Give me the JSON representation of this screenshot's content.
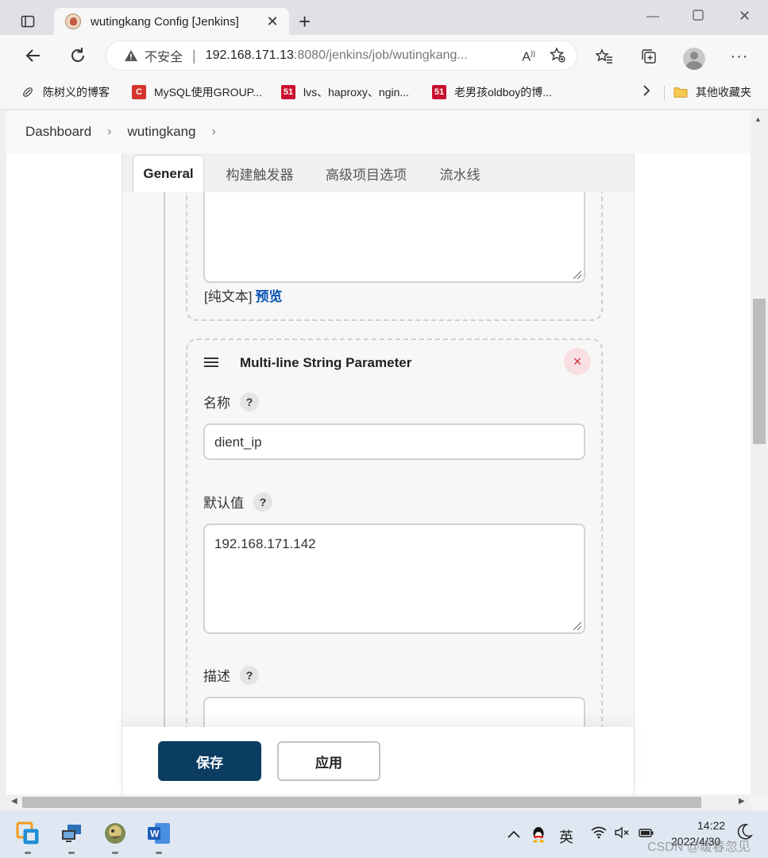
{
  "browser": {
    "tab_title": "wutingkang Config [Jenkins]",
    "security_label": "不安全",
    "url_host": "192.168.171.13",
    "url_rest": ":8080/jenkins/job/wutingkang..."
  },
  "bookmarks": [
    {
      "label": "陈树义的博客",
      "icon": "link-icon"
    },
    {
      "label": "MySQL使用GROUP...",
      "icon": "csdn-icon",
      "badge": "C",
      "color": "#d4342b"
    },
    {
      "label": "lvs、haproxy、ngin...",
      "icon": "51cto-icon",
      "badge": "51",
      "color": "#c8102e"
    },
    {
      "label": "老男孩oldboy的博...",
      "icon": "51cto-icon",
      "badge": "51",
      "color": "#c8102e"
    }
  ],
  "other_bookmarks": "其他收藏夹",
  "breadcrumb": {
    "dashboard": "Dashboard",
    "job": "wutingkang"
  },
  "config_tabs": [
    "General",
    "构建触发器",
    "高级项目选项",
    "流水线"
  ],
  "previous_param": {
    "format_label": "[纯文本]",
    "preview_link": "预览"
  },
  "param": {
    "title": "Multi-line String Parameter",
    "name_label": "名称",
    "name_value": "dient_ip",
    "default_label": "默认值",
    "default_value": "192.168.171.142",
    "description_label": "描述",
    "help": "?",
    "delete": "×"
  },
  "actions": {
    "save": "保存",
    "apply": "应用"
  },
  "taskbar": {
    "ime": "英",
    "time": "14:22",
    "date": "2022/4/30"
  },
  "watermark": "CSDN @暖春忽见",
  "colors": {
    "save_bg": "#0b3d62",
    "link": "#0b56b6",
    "delete": "#d22b3c"
  }
}
